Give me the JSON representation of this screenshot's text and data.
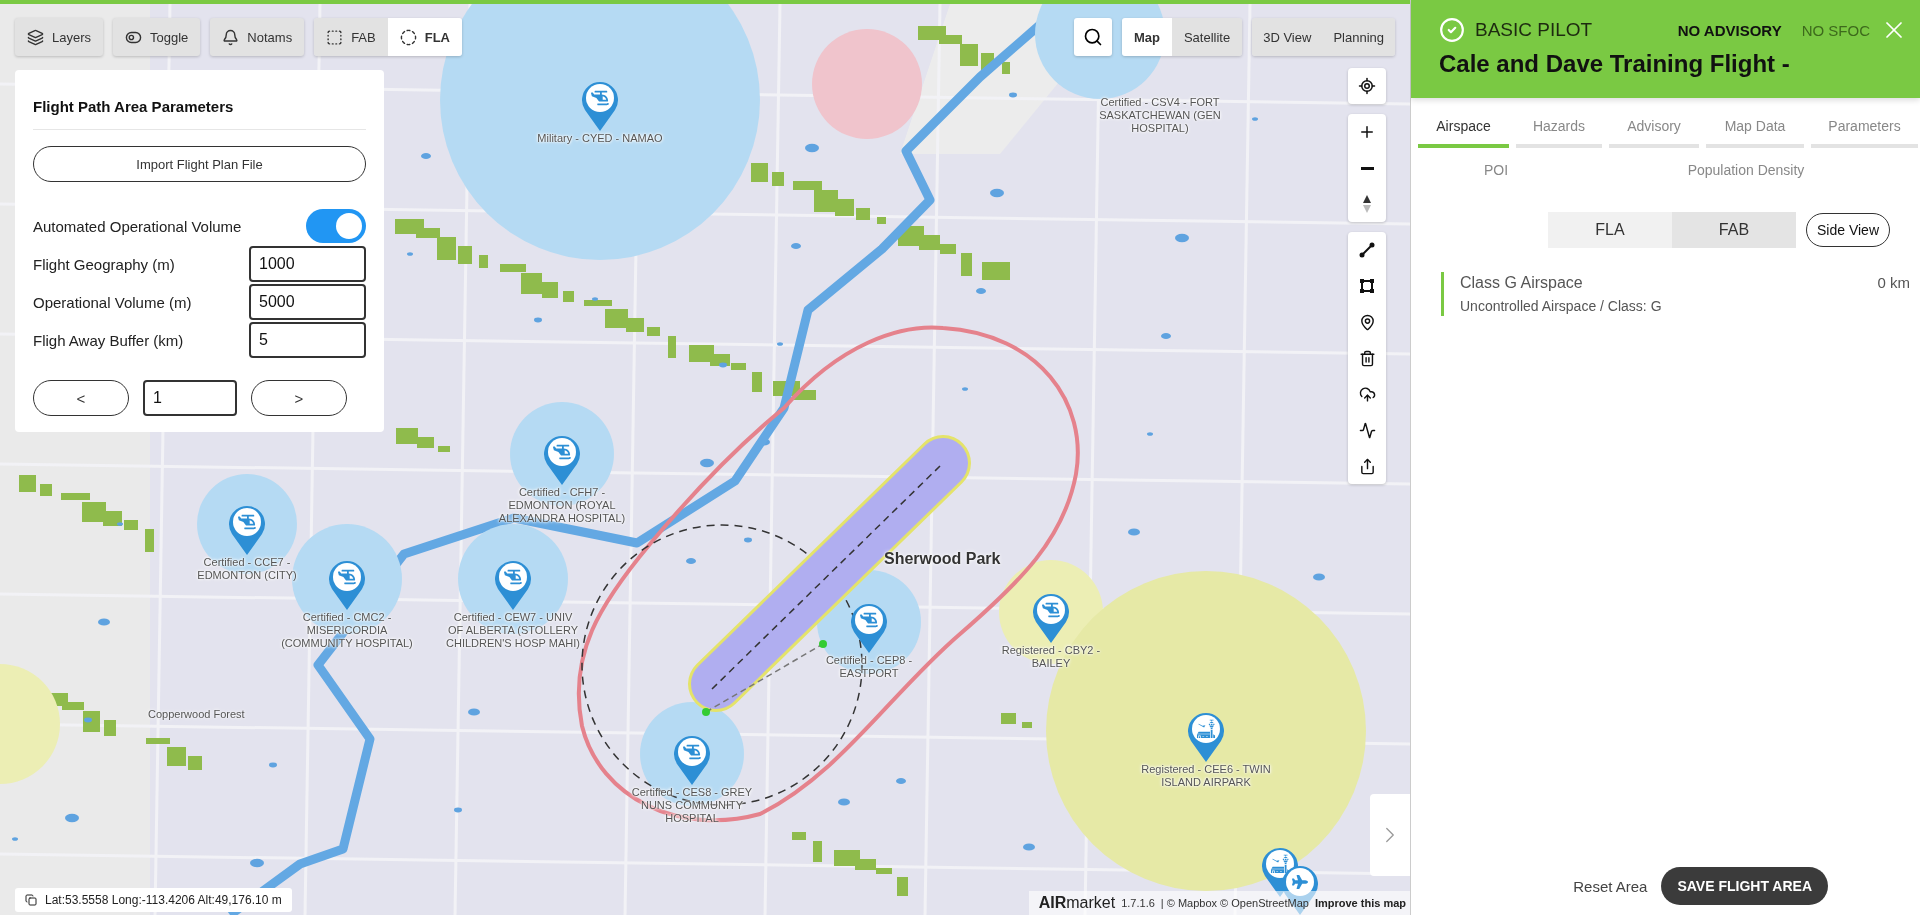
{
  "toolbar": {
    "buttons": [
      {
        "label": "Layers",
        "kind": "layers"
      },
      {
        "label": "Toggle",
        "kind": "toggle"
      },
      {
        "label": "Notams",
        "kind": "notams"
      }
    ],
    "mode_tabs": [
      {
        "label": "FAB",
        "kind": "box",
        "selected": false
      },
      {
        "label": "FLA",
        "kind": "circle",
        "selected": true
      }
    ],
    "map_type_tabs": [
      {
        "label": "Map",
        "selected": true
      },
      {
        "label": "Satellite",
        "selected": false
      }
    ],
    "view_buttons": [
      "3D View",
      "Planning"
    ]
  },
  "flight_panel": {
    "title": "Flight Path Area Parameters",
    "import_button": "Import Flight Plan File",
    "automated": {
      "label": "Automated Operational Volume",
      "on": true
    },
    "fields": [
      {
        "label": "Flight Geography (m)",
        "value": "1000"
      },
      {
        "label": "Operational Volume (m)",
        "value": "5000"
      },
      {
        "label": "Fligh Away Buffer (km)",
        "value": "5"
      }
    ],
    "pager": {
      "prev": "<",
      "page": "1",
      "next": ">"
    }
  },
  "map": {
    "markers": [
      {
        "label": "Military - CYED - NAMAO",
        "kind": "heliport",
        "color": "#b5daf3"
      },
      {
        "label": "Certified - CSV4 - FORT SASKATCHEWAN (GEN HOSPITAL)",
        "kind": "covered",
        "color": "#b5daf3"
      },
      {
        "label": "Certified - CFH7 - EDMONTON (ROYAL ALEXANDRA HOSPITAL)",
        "kind": "heliport",
        "color": "#b5daf3"
      },
      {
        "label": "Certified - CCE7 - EDMONTON (CITY)",
        "kind": "heliport",
        "color": "#b5daf3"
      },
      {
        "label": "Certified - CMC2 - MISERICORDIA (COMMUNITY HOSPITAL)",
        "kind": "heliport",
        "color": "#b5daf3"
      },
      {
        "label": "Certified - CEW7 - UNIV OF ALBERTA (STOLLERY CHILDREN'S HOSP MAHI)",
        "kind": "heliport",
        "color": "#b5daf3"
      },
      {
        "label": "Certified - CEP8 - EASTPORT",
        "kind": "heliport",
        "color": "#b5daf3"
      },
      {
        "label": "Certified - CES8 - GREY NUNS COMMUNITY HOSPITAL",
        "kind": "heliport",
        "color": "#b5daf3"
      },
      {
        "label": "Registered - CBY2 - BAILEY",
        "kind": "heliport",
        "color": "#eceeb4"
      },
      {
        "label": "Registered - CEE6 - TWIN ISLAND AIRPARK",
        "kind": "aerodrome",
        "color": "#e6e9a6"
      }
    ],
    "place_labels": [
      "Sherwood Park",
      "Copperwood Forest"
    ],
    "coordinates": "Lat:53.5558 Long:-113.4206 Alt:49,176.10 m",
    "attribution": {
      "logo": "**AIR**market",
      "version": "1.7.1.6",
      "text": "| © Mapbox © OpenStreetMap",
      "link": "Improve this map"
    }
  },
  "right_panel": {
    "pilot_level": "BASIC PILOT",
    "advisory": "NO ADVISORY",
    "sfoc": "NO SFOC",
    "title": "Cale and Dave Training Flight -",
    "tabs": [
      {
        "label": "Airspace",
        "selected": true
      },
      {
        "label": "Hazards",
        "selected": false
      },
      {
        "label": "Advisory",
        "selected": false
      },
      {
        "label": "Map Data",
        "selected": false
      },
      {
        "label": "Parameters",
        "selected": false
      }
    ],
    "sub_tabs": [
      {
        "label": "POI",
        "selected": false
      },
      {
        "label": "Population Density",
        "selected": false
      }
    ],
    "view_tabs": [
      {
        "label": "FLA",
        "selected": false
      },
      {
        "label": "FAB",
        "selected": true
      }
    ],
    "side_view_button": "Side View",
    "airspaces": [
      {
        "title": "Class G Airspace",
        "subtitle": "Uncontrolled Airspace / Class: G",
        "distance": "0 km"
      }
    ],
    "reset_link": "Reset Area",
    "save_button": "SAVE FLIGHT AREA"
  }
}
